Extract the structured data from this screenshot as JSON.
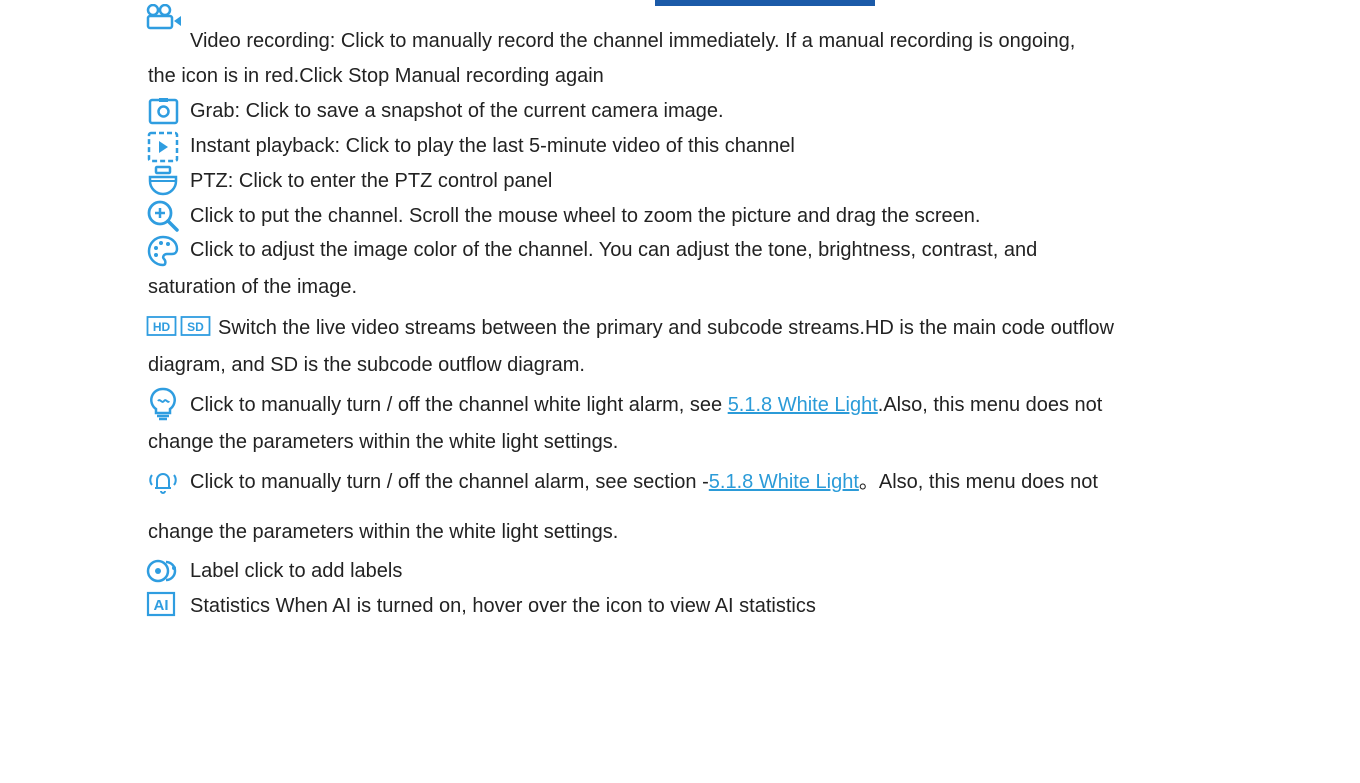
{
  "colors": {
    "icon": "#2f9de0",
    "link": "#2b9bd8",
    "text": "#222222"
  },
  "items": [
    {
      "icon": "video-recording-icon",
      "lines": [
        "Video recording: Click to manually record the channel immediately. If a manual recording is ongoing,",
        "the icon is in red.Click Stop Manual recording again"
      ]
    },
    {
      "icon": "camera-grab-icon",
      "lines": [
        "Grab: Click to save a snapshot of the current camera image."
      ]
    },
    {
      "icon": "instant-playback-icon",
      "lines": [
        "Instant playback: Click to play the last 5-minute video of this channel"
      ]
    },
    {
      "icon": "ptz-icon",
      "lines": [
        "PTZ: Click to enter the PTZ control panel"
      ]
    },
    {
      "icon": "zoom-in-icon",
      "lines": [
        "Click to put the channel. Scroll the mouse wheel to zoom the picture and drag the screen."
      ]
    },
    {
      "icon": "palette-icon",
      "lines": [
        "Click to adjust the image color of the channel. You can adjust the tone, brightness, contrast, and",
        "saturation of the image."
      ]
    },
    {
      "icon": "hd-sd-icon",
      "icon_labels": [
        "HD",
        "SD"
      ],
      "lines": [
        "Switch the live video streams between the primary and subcode streams.HD is the main code outflow",
        "diagram, and SD is the subcode outflow diagram."
      ]
    },
    {
      "icon": "white-light-icon",
      "line1_before": "Click to manually turn / off the channel white light alarm, see ",
      "link": "5.1.8 White Light",
      "line1_after": ".Also, this menu does not",
      "line2": "change the parameters within the white light settings."
    },
    {
      "icon": "alarm-bell-icon",
      "line1_before": "Click to manually turn / off the channel alarm, see section -",
      "link": "5.1.8 White Light",
      "line1_after": "。Also, this menu does not",
      "line2": "change the parameters within the white light settings."
    },
    {
      "icon": "label-icon",
      "lines": [
        "Label click to add labels"
      ]
    },
    {
      "icon": "ai-statistics-icon",
      "icon_labels": [
        "AI"
      ],
      "lines": [
        "Statistics When AI is turned on, hover over the icon to view AI statistics"
      ]
    }
  ]
}
